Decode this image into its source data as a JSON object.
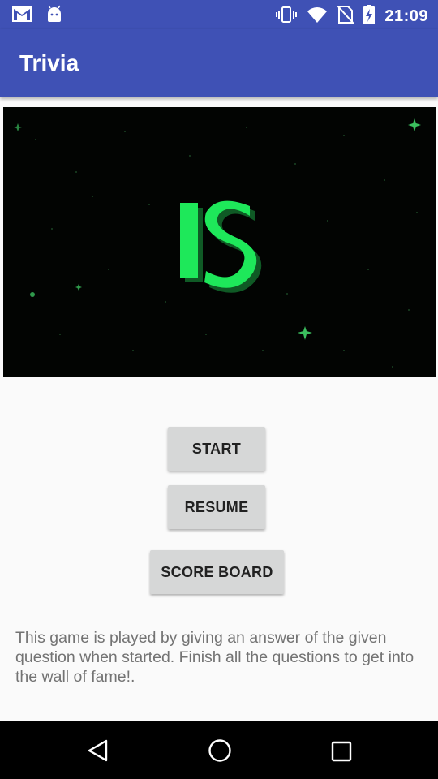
{
  "status_bar": {
    "time": "21:09",
    "left_icons": [
      "gmail-icon",
      "android-icon"
    ],
    "right_icons": [
      "vibrate-icon",
      "wifi-icon",
      "no-sim-icon",
      "battery-charging-icon"
    ]
  },
  "app_bar": {
    "title": "Trivia"
  },
  "banner": {
    "logo_text": "IS"
  },
  "buttons": {
    "start": "START",
    "resume": "RESUME",
    "score_board": "SCORE BOARD"
  },
  "description": "This game is played by giving an answer of the given question when started. Finish all the questions to get into the wall of fame!.",
  "nav_bar": {
    "icons": [
      "back-icon",
      "home-icon",
      "recents-icon"
    ]
  },
  "colors": {
    "primary": "#3f51b5",
    "background": "#fafafa",
    "button": "#d6d7d7",
    "banner_bg": "#020402",
    "logo_green": "#1ee85a"
  }
}
